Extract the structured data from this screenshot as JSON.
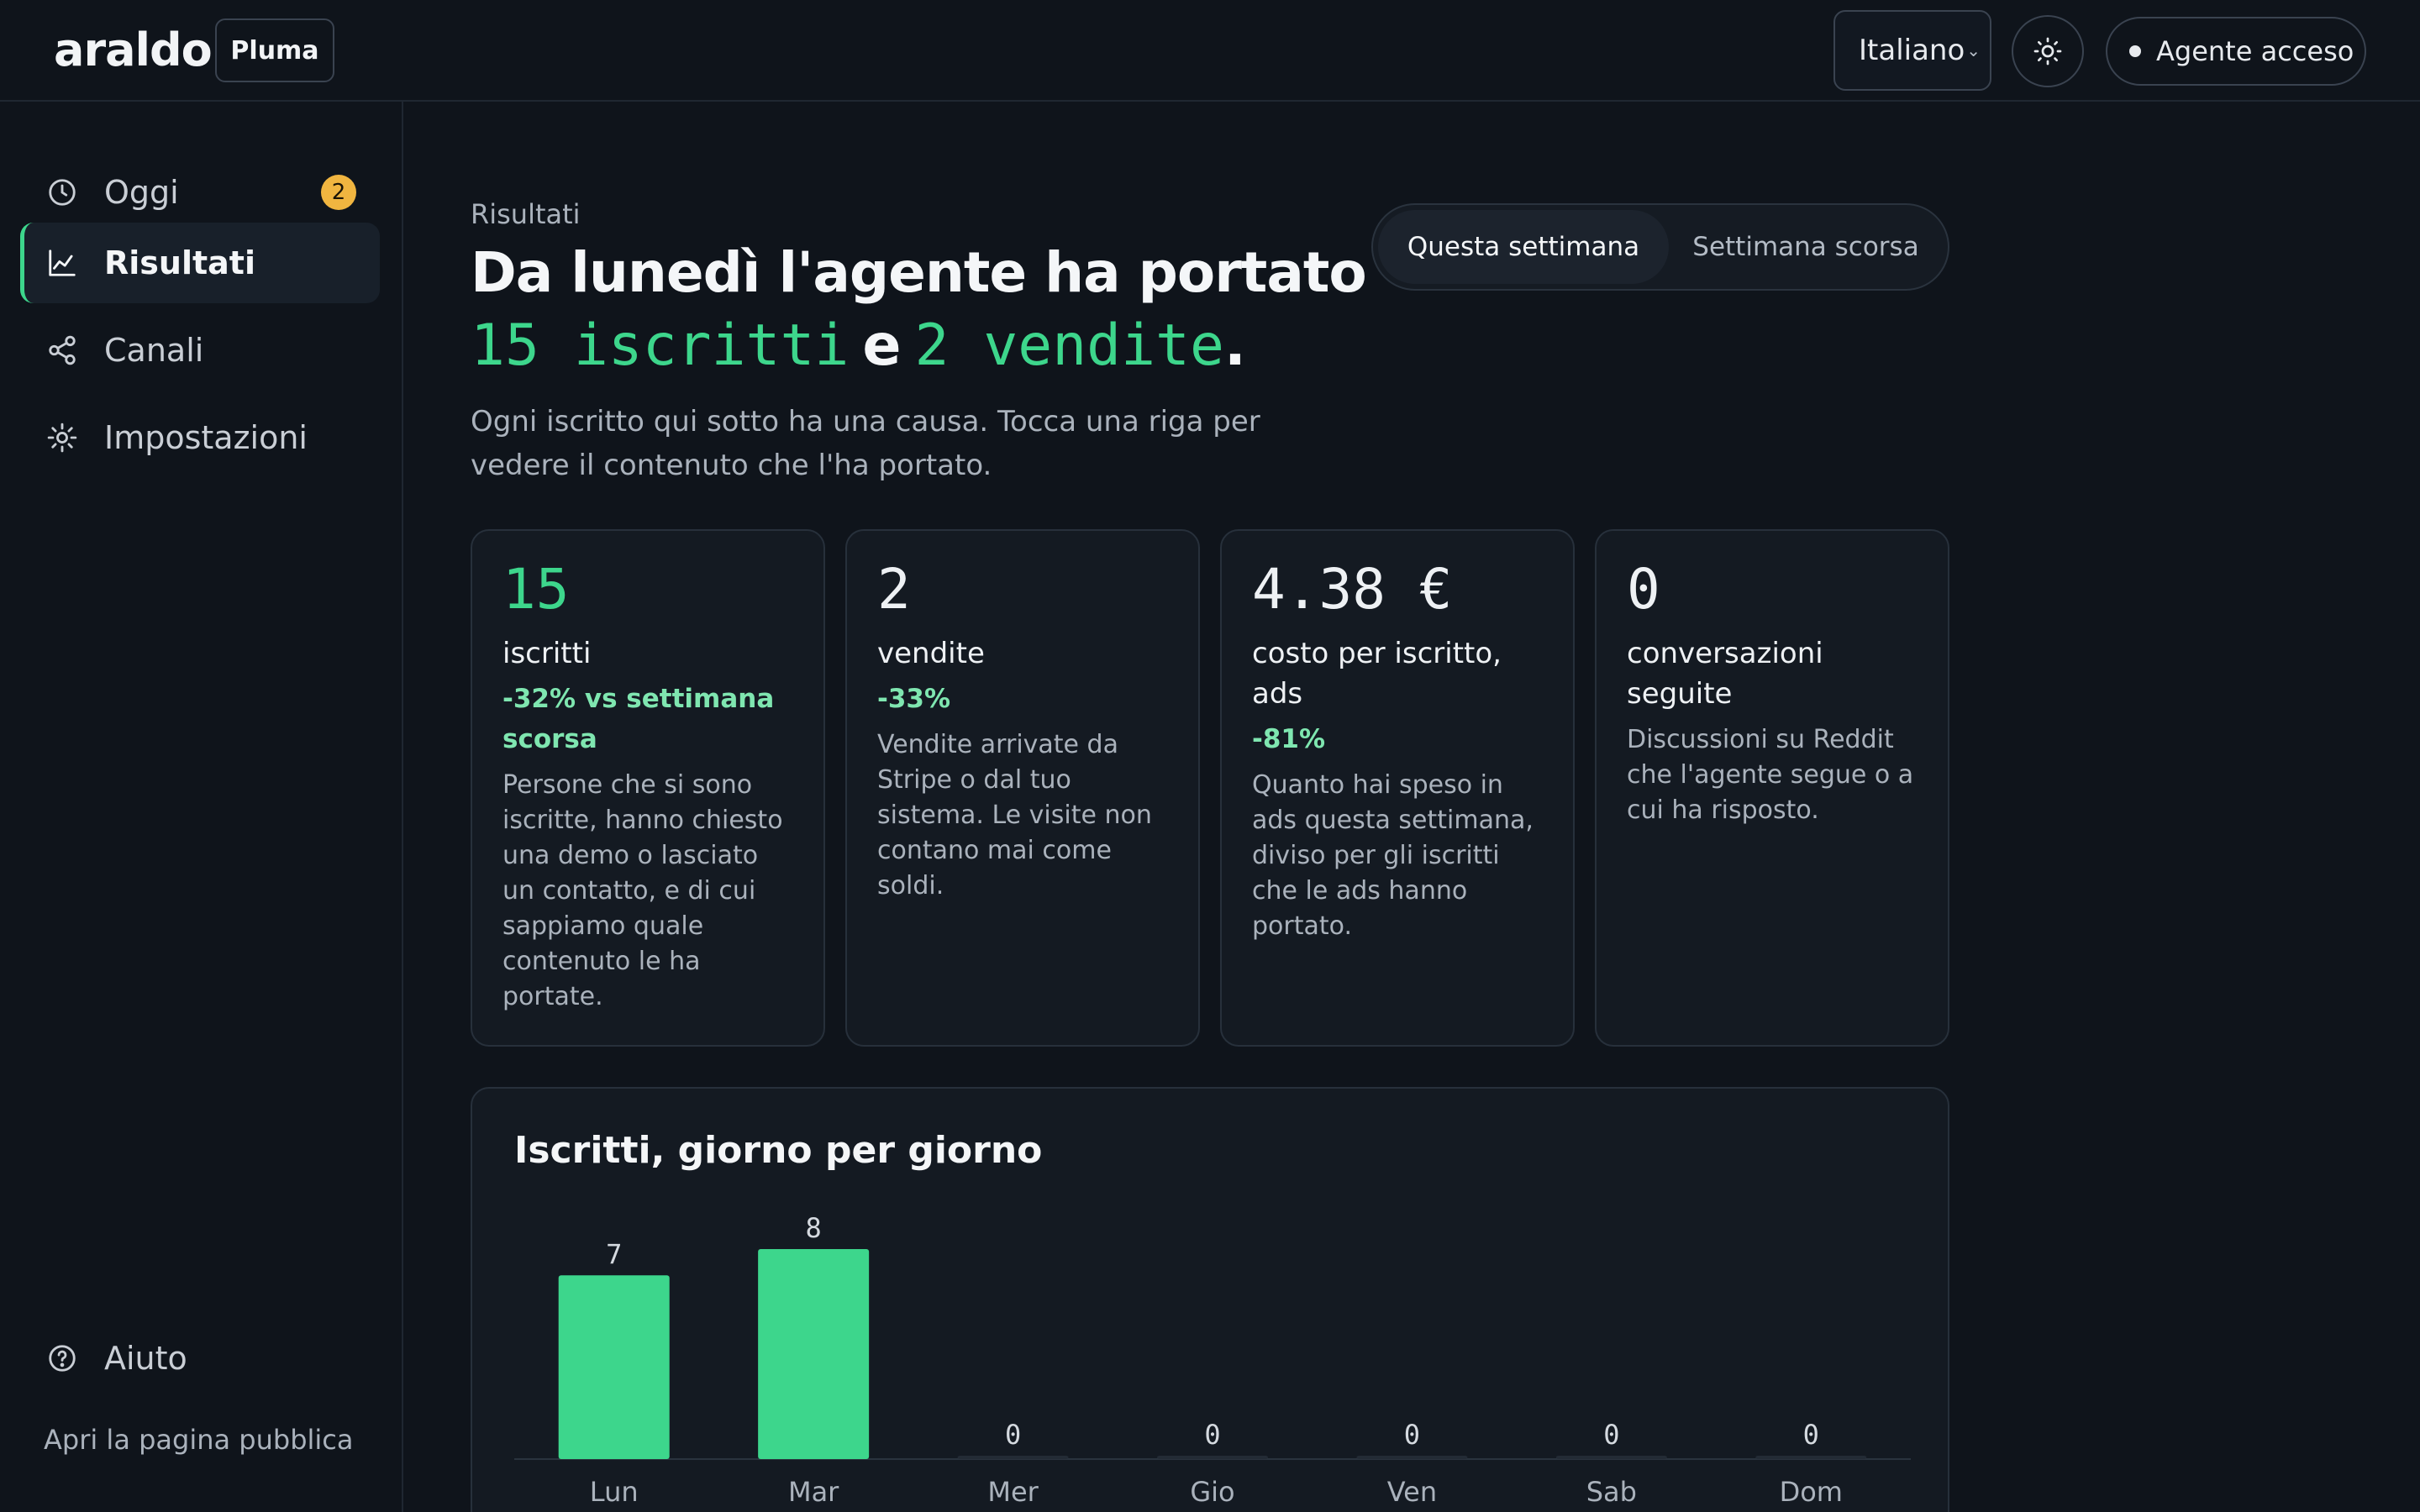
{
  "header": {
    "logo": "araldo",
    "project": "Pluma",
    "language": "Italiano",
    "agent_status": "Agente acceso"
  },
  "sidebar": {
    "items": [
      {
        "label": "Oggi",
        "icon": "clock-icon",
        "badge": "2"
      },
      {
        "label": "Risultati",
        "icon": "chart-line-icon",
        "active": true
      },
      {
        "label": "Canali",
        "icon": "share-icon"
      },
      {
        "label": "Impostazioni",
        "icon": "gear-icon"
      }
    ],
    "help": "Aiuto",
    "public_link": "Apri la pagina pubblica"
  },
  "main": {
    "eyebrow": "Risultati",
    "headline": "Da lunedì l'agente ha portato",
    "headline_subs": "15 iscritti",
    "headline_conj": "e",
    "headline_sales": "2 vendite",
    "headline_end": ".",
    "subtitle": "Ogni iscritto qui sotto ha una causa. Tocca una riga per vedere il contenuto che l'ha portato.",
    "period_toggle": {
      "selected": "Questa settimana",
      "other": "Settimana scorsa"
    },
    "cards": [
      {
        "value": "15",
        "label": "iscritti",
        "delta": "-32% vs settimana scorsa",
        "desc": "Persone che si sono iscritte, hanno chiesto una demo o lasciato un contatto, e di cui sappiamo quale contenuto le ha portate."
      },
      {
        "value": "2",
        "label": "vendite",
        "delta": "-33%",
        "desc": "Vendite arrivate da Stripe o dal tuo sistema. Le visite non contano mai come soldi."
      },
      {
        "value": "4.38 €",
        "label": "costo per iscritto, ads",
        "delta": "-81%",
        "desc": "Quanto hai speso in ads questa settimana, diviso per gli iscritti che le ads hanno portato."
      },
      {
        "value": "0",
        "label": "conversazioni seguite",
        "delta": "",
        "desc": "Discussioni su Reddit che l'agente segue o a cui ha risposto."
      }
    ]
  },
  "colors": {
    "accent": "#3dd68c",
    "badge": "#f0b540",
    "background": "#0f141b"
  },
  "chart_data": {
    "type": "bar",
    "title": "Iscritti, giorno per giorno",
    "categories": [
      "Lun",
      "Mar",
      "Mer",
      "Gio",
      "Ven",
      "Sab",
      "Dom"
    ],
    "values": [
      7,
      8,
      0,
      0,
      0,
      0,
      0
    ],
    "xlabel": "",
    "ylabel": "",
    "ylim": [
      0,
      8
    ],
    "grid": false
  }
}
